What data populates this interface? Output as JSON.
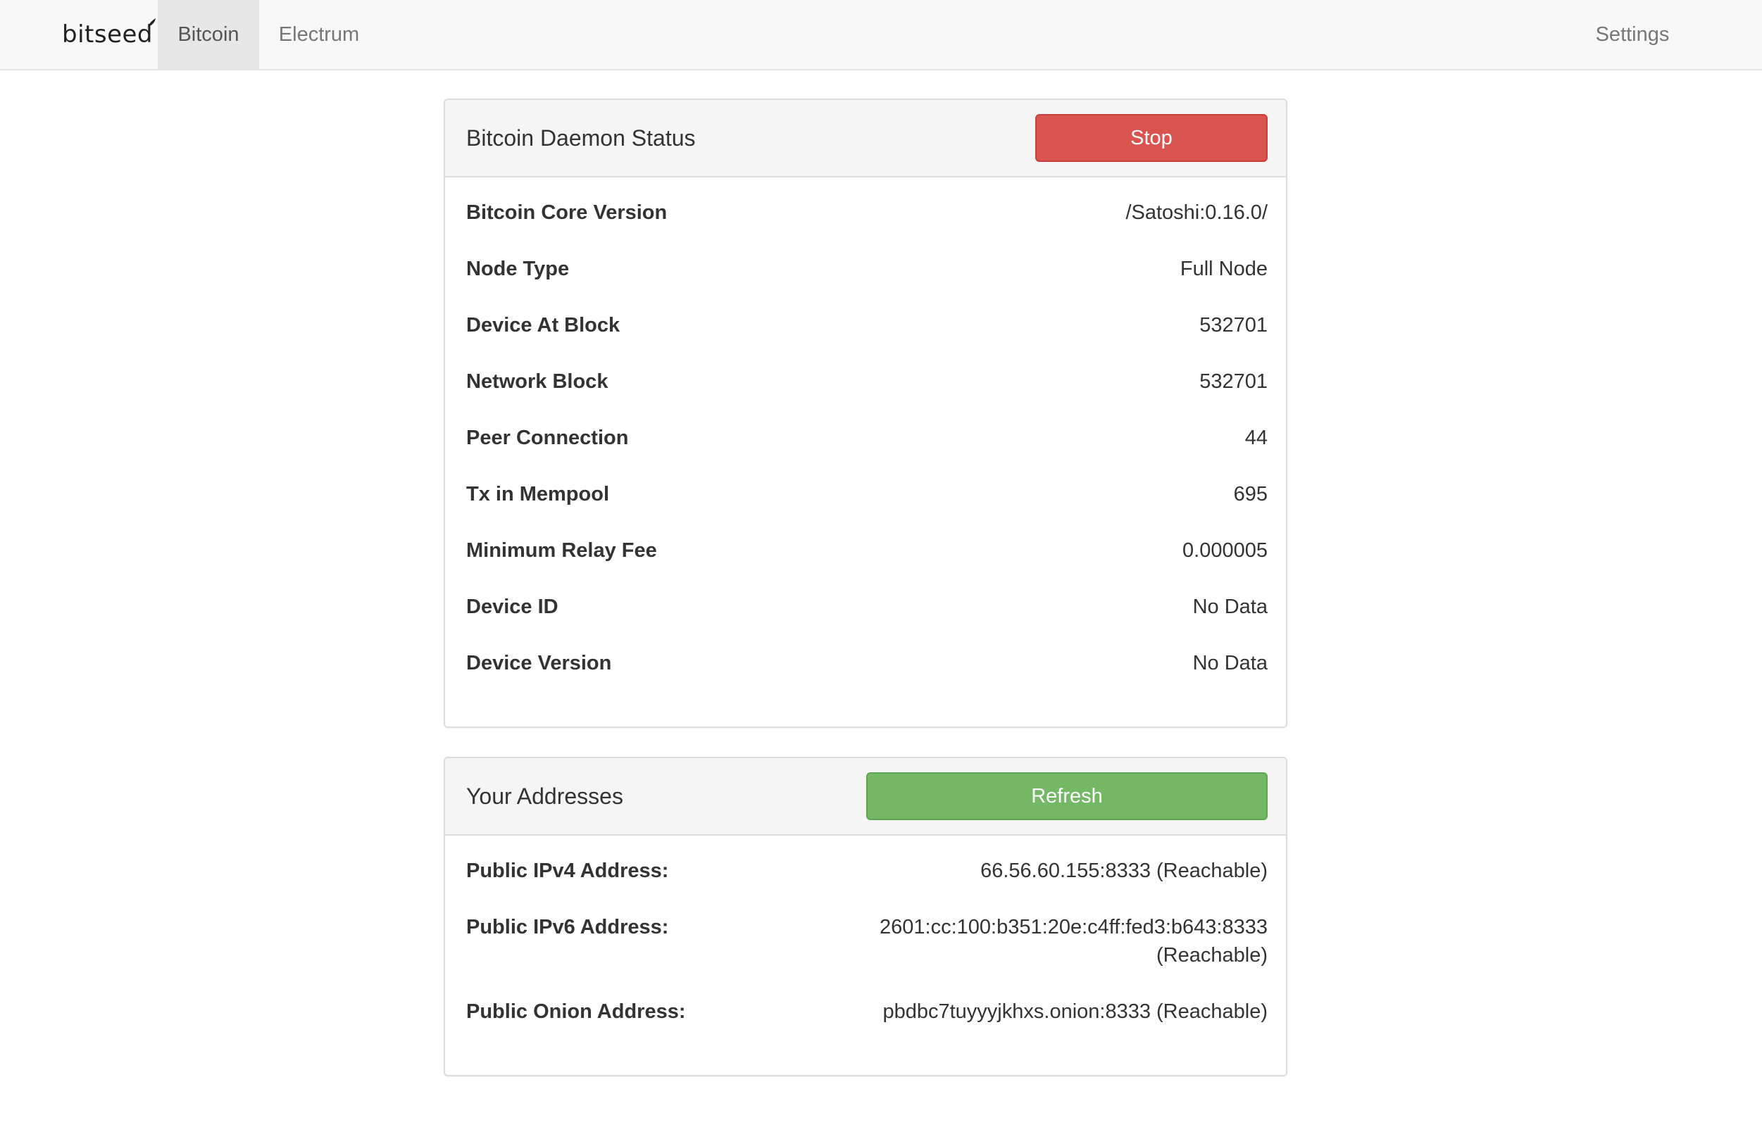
{
  "navbar": {
    "brand": "bitseed",
    "tabs": [
      {
        "label": "Bitcoin",
        "active": true
      },
      {
        "label": "Electrum",
        "active": false
      }
    ],
    "settings_label": "Settings"
  },
  "daemon_panel": {
    "title": "Bitcoin Daemon Status",
    "stop_label": "Stop",
    "rows": [
      {
        "label": "Bitcoin Core Version",
        "value": "/Satoshi:0.16.0/"
      },
      {
        "label": "Node Type",
        "value": "Full Node"
      },
      {
        "label": "Device At Block",
        "value": "532701"
      },
      {
        "label": "Network Block",
        "value": "532701"
      },
      {
        "label": "Peer Connection",
        "value": "44"
      },
      {
        "label": "Tx in Mempool",
        "value": "695"
      },
      {
        "label": "Minimum Relay Fee",
        "value": "0.000005"
      },
      {
        "label": "Device ID",
        "value": "No Data"
      },
      {
        "label": "Device Version",
        "value": "No Data"
      }
    ]
  },
  "addresses_panel": {
    "title": "Your Addresses",
    "refresh_label": "Refresh",
    "rows": [
      {
        "label": "Public IPv4 Address:",
        "value": "66.56.60.155:8333 (Reachable)"
      },
      {
        "label": "Public IPv6 Address:",
        "value": "2601:cc:100:b351:20e:c4ff:fed3:b643:8333 (Reachable)"
      },
      {
        "label": "Public Onion Address:",
        "value": "pbdbc7tuyyyjkhxs.onion:8333 (Reachable)"
      }
    ]
  },
  "colors": {
    "stop_button": "#d9534f",
    "refresh_button": "#74b866",
    "navbar_bg": "#f8f8f8",
    "active_tab_bg": "#e7e7e7"
  }
}
